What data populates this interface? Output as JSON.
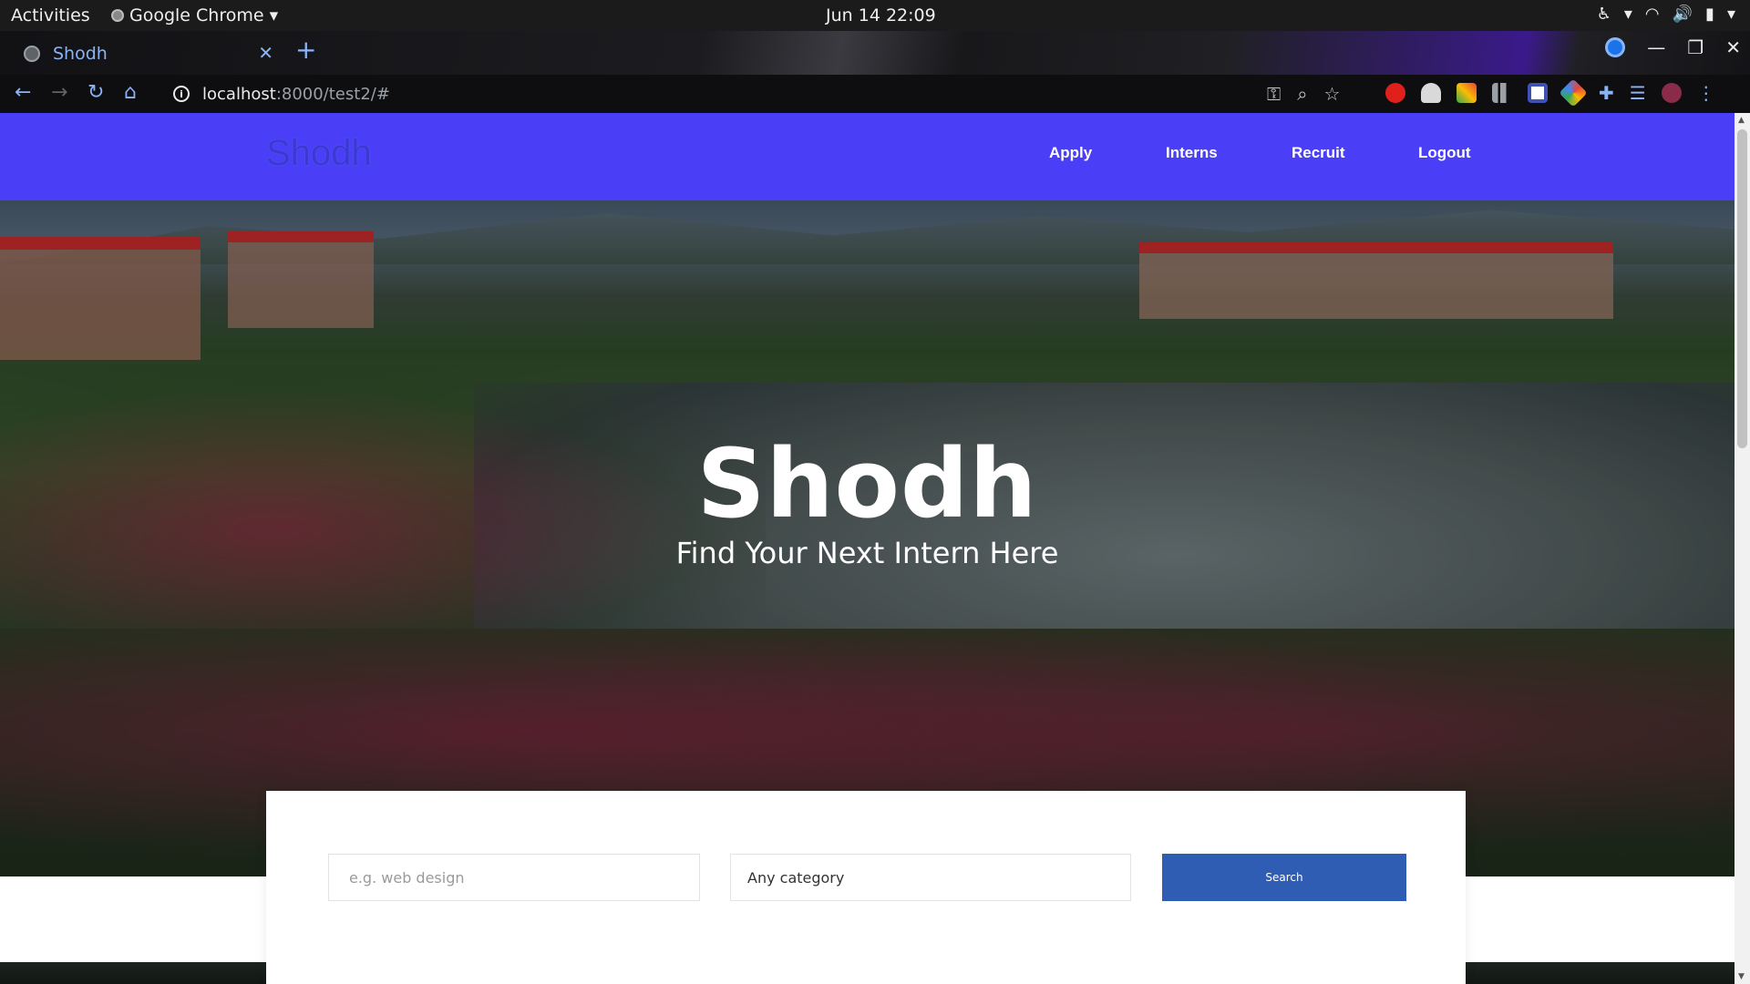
{
  "os": {
    "activities": "Activities",
    "app_name": "Google Chrome",
    "clock": "Jun 14  22:09"
  },
  "browser": {
    "tab_title": "Shodh",
    "url_host": "localhost",
    "url_path": ":8000/test2/#"
  },
  "site": {
    "logo": "Shodh",
    "nav": [
      {
        "label": "Apply"
      },
      {
        "label": "Interns"
      },
      {
        "label": "Recruit"
      },
      {
        "label": "Logout"
      }
    ],
    "nav_color": "#4a3ff7"
  },
  "hero": {
    "title": "Shodh",
    "subtitle": "Find Your Next Intern Here"
  },
  "search": {
    "placeholder": "e.g. web design",
    "category": "Any category",
    "button": "Search",
    "button_color": "#2e5db3"
  }
}
